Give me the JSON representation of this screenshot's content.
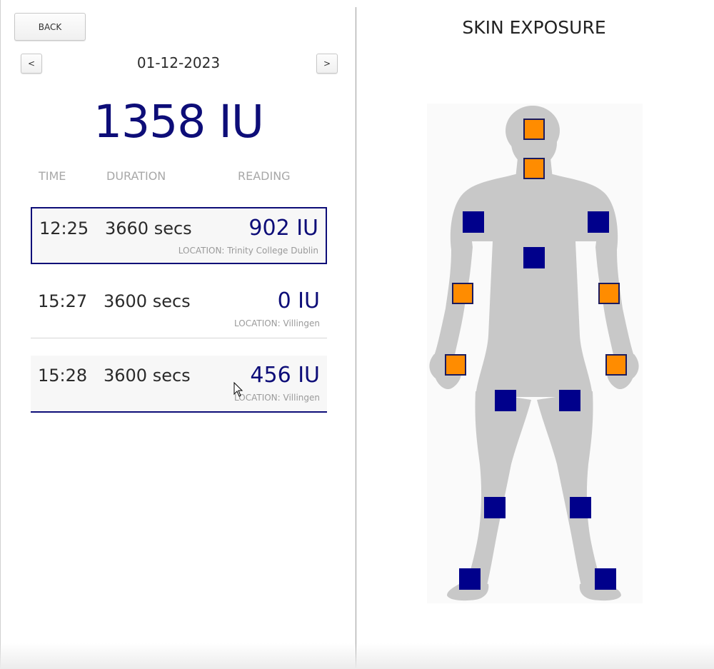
{
  "nav": {
    "back_label": "BACK",
    "prev_label": "<",
    "next_label": ">"
  },
  "date": "01-12-2023",
  "total_reading": "1358 IU",
  "columns": {
    "time": "TIME",
    "duration": "DURATION",
    "reading": "READING"
  },
  "entries": [
    {
      "time": "12:25",
      "duration": "3660 secs",
      "reading": "902 IU",
      "location": "LOCATION: Trinity College Dublin"
    },
    {
      "time": "15:27",
      "duration": "3600 secs",
      "reading": "0 IU",
      "location": "LOCATION: Villingen"
    },
    {
      "time": "15:28",
      "duration": "3600 secs",
      "reading": "456 IU",
      "location": "LOCATION: Villingen"
    }
  ],
  "panel": {
    "title": "SKIN EXPOSURE"
  },
  "colors": {
    "accent": "#0d0d78",
    "exposed": "#ff8c00",
    "unexposed": "#00008b",
    "body": "#c8c8c8"
  },
  "body_regions": [
    {
      "name": "head",
      "status": "exposed"
    },
    {
      "name": "neck",
      "status": "exposed"
    },
    {
      "name": "right-shoulder",
      "status": "covered"
    },
    {
      "name": "left-shoulder",
      "status": "covered"
    },
    {
      "name": "chest",
      "status": "covered"
    },
    {
      "name": "right-forearm",
      "status": "exposed"
    },
    {
      "name": "left-forearm",
      "status": "exposed"
    },
    {
      "name": "right-hand",
      "status": "exposed"
    },
    {
      "name": "left-hand",
      "status": "exposed"
    },
    {
      "name": "right-thigh",
      "status": "covered"
    },
    {
      "name": "left-thigh",
      "status": "covered"
    },
    {
      "name": "right-shin",
      "status": "covered"
    },
    {
      "name": "left-shin",
      "status": "covered"
    },
    {
      "name": "right-foot",
      "status": "covered"
    },
    {
      "name": "left-foot",
      "status": "covered"
    }
  ]
}
